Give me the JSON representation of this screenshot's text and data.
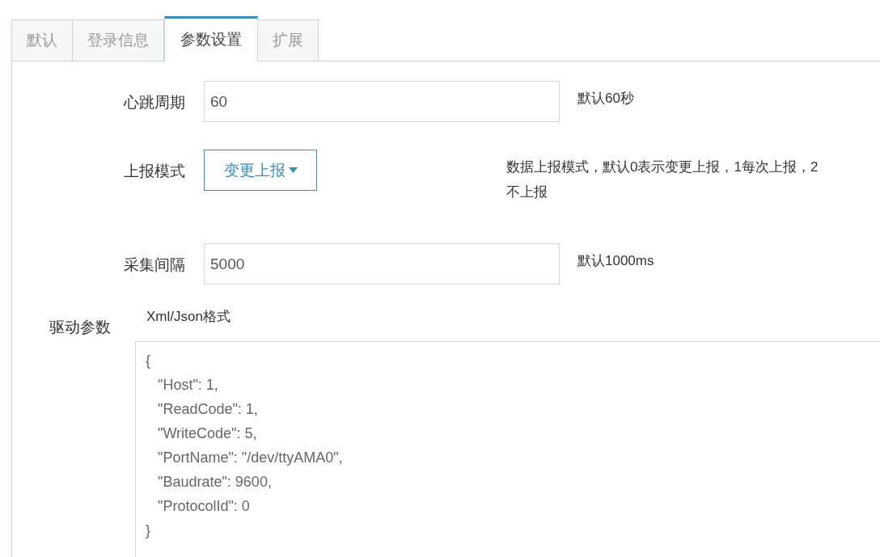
{
  "tabs": [
    {
      "label": "默认",
      "selected": false
    },
    {
      "label": "登录信息",
      "selected": false
    },
    {
      "label": "参数设置",
      "selected": true
    },
    {
      "label": "扩展",
      "selected": false
    }
  ],
  "fields": [
    {
      "kind": "input",
      "label": "心跳周期",
      "value": "60",
      "hint": "默认60秒"
    },
    {
      "kind": "select",
      "label": "上报模式",
      "value": "变更上报",
      "hint": "数据上报模式，默认0表示变更上报，1每次上报，2不上报"
    },
    {
      "kind": "input",
      "label": "采集间隔",
      "value": "5000",
      "hint": "默认1000ms"
    }
  ],
  "driver": {
    "label": "驱动参数",
    "format": "Xml/Json格式",
    "value": "{\n   \"Host\": 1,\n   \"ReadCode\": 1,\n   \"WriteCode\": 5,\n   \"PortName\": \"/dev/ttyAMA0\",\n   \"Baudrate\": 9600,\n   \"ProtocolId\": 0\n}"
  }
}
